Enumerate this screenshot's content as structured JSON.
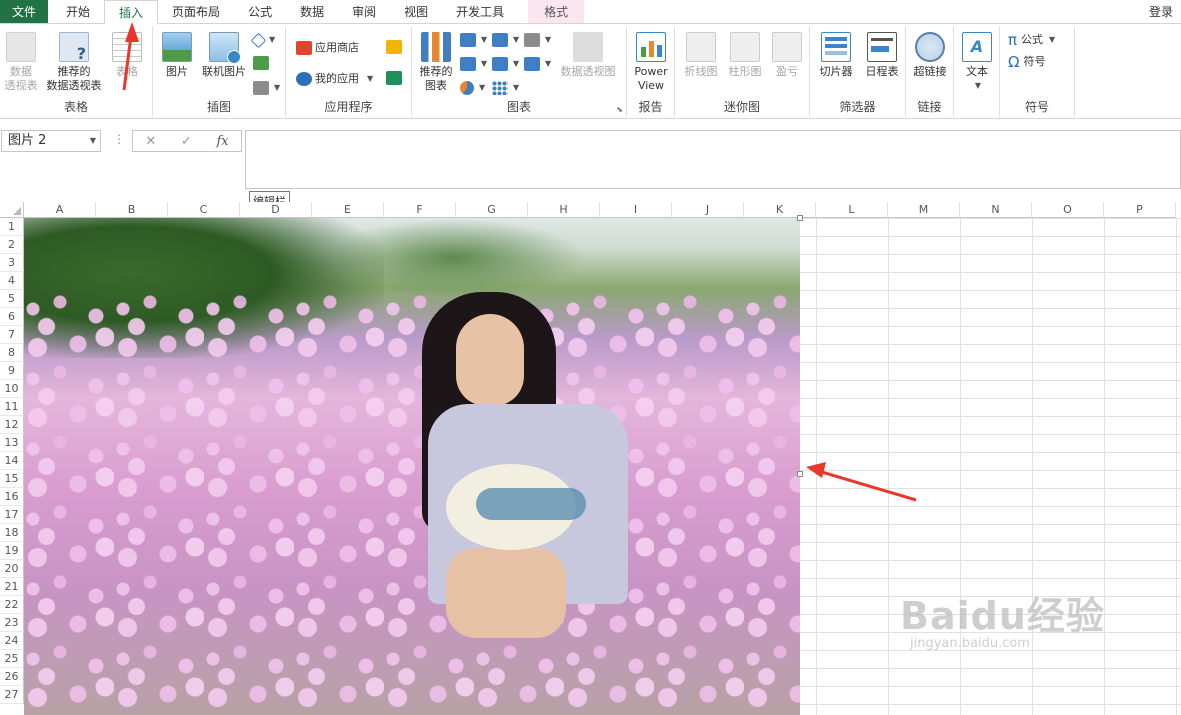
{
  "tabs": {
    "file": "文件",
    "items": [
      "开始",
      "插入",
      "页面布局",
      "公式",
      "数据",
      "审阅",
      "视图",
      "开发工具"
    ],
    "context": "格式",
    "login": "登录",
    "active": "插入"
  },
  "ribbon": {
    "groups": {
      "tables": "表格",
      "illustrations": "插图",
      "apps": "应用程序",
      "charts": "图表",
      "reports": "报告",
      "sparklines": "迷你图",
      "filters": "筛选器",
      "links": "链接",
      "symbols": "符号"
    },
    "buttons": {
      "pivot": "数据\n透视表",
      "recommended_pivot": "推荐的\n数据透视表",
      "table": "表格",
      "picture": "图片",
      "online_picture": "联机图片",
      "app_store": "应用商店",
      "my_apps": "我的应用",
      "recommended_charts": "推荐的\n图表",
      "pivot_chart": "数据透视图",
      "power_view": "Power\nView",
      "line": "折线图",
      "column": "柱形图",
      "win_loss": "盈亏",
      "slicer": "切片器",
      "timeline": "日程表",
      "hyperlink": "超链接",
      "text": "文本",
      "equation": "公式",
      "symbol": "符号"
    }
  },
  "formula_bar": {
    "name_box": "图片 2",
    "fx": "fx",
    "tooltip": "编辑栏"
  },
  "grid": {
    "columns": [
      "A",
      "B",
      "C",
      "D",
      "E",
      "F",
      "G",
      "H",
      "I",
      "J",
      "K",
      "L",
      "M",
      "N",
      "O",
      "P"
    ],
    "rows": [
      "1",
      "2",
      "3",
      "4",
      "5",
      "6",
      "7",
      "8",
      "9",
      "10",
      "11",
      "12",
      "13",
      "14",
      "15",
      "16",
      "17",
      "18",
      "19",
      "20",
      "21",
      "22",
      "23",
      "24",
      "25",
      "26",
      "27"
    ]
  },
  "watermark": {
    "brand": "Baidu经验",
    "url": "jingyan.baidu.com"
  },
  "colors": {
    "excel_green": "#217346",
    "context_tab": "#fbe5ef",
    "annotation_red": "#e8372b"
  }
}
